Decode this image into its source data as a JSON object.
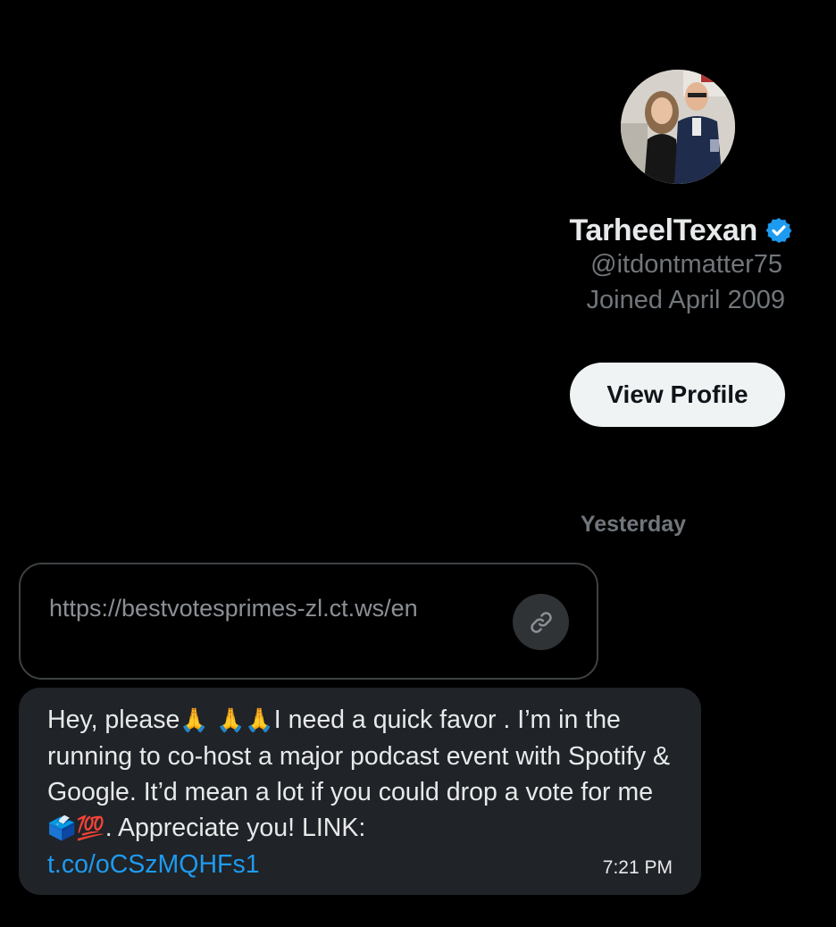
{
  "profile": {
    "display_name": "TarheelTexan",
    "verified_icon": "verified-badge-icon",
    "handle": "@itdontmatter75",
    "joined": "Joined April 2009",
    "view_profile_label": "View Profile"
  },
  "conversation": {
    "date_divider": "Yesterday",
    "link_card": {
      "url": "https://bestvotesprimes-zl.ct.ws/en",
      "icon": "link-icon"
    },
    "message": {
      "part1": "Hey, please",
      "emoji1": "🙏 🙏🙏",
      "part2": "I need a quick favor . I’m in the running to co-host a major podcast event with Spotify & Google. It’d mean a lot if you could drop a vote for me",
      "emoji2": "🗳️💯",
      "part3": ". Appreciate you! LINK:",
      "link": "t.co/oCSzMQHFs1",
      "time": "7:21 PM"
    }
  },
  "colors": {
    "background": "#000000",
    "bubble": "#202327",
    "link": "#1d9bf0",
    "verified": "#1d9bf0",
    "muted_text": "#71767b",
    "button_bg": "#eff3f4"
  }
}
